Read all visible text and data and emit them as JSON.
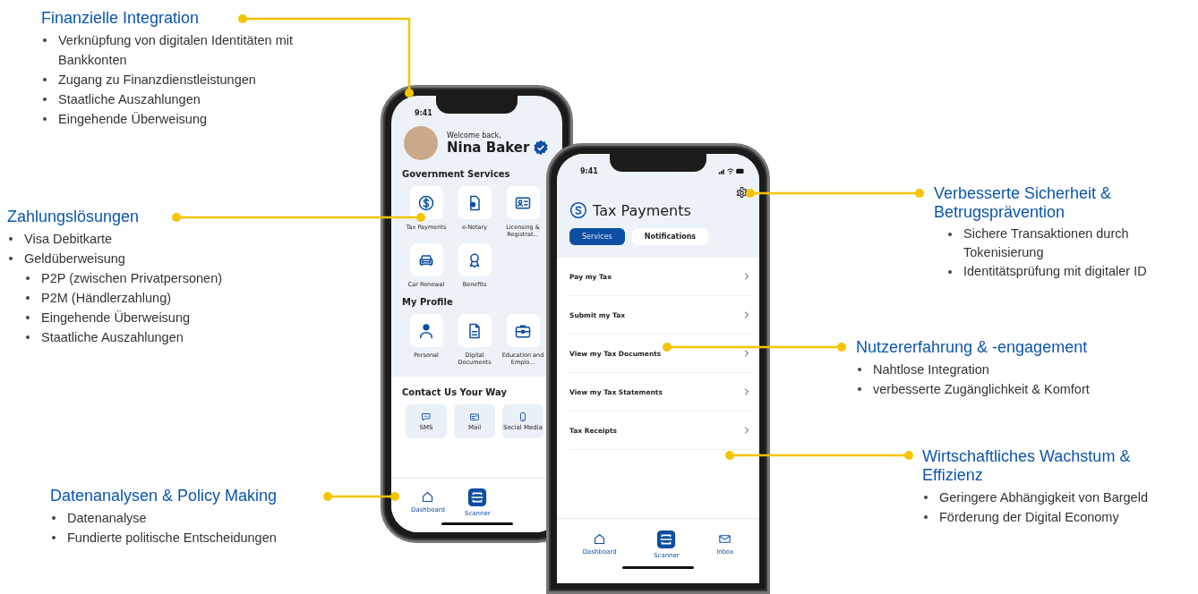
{
  "left_callouts": [
    {
      "title": "Finanzielle Integration",
      "bullets": [
        {
          "text": "Verknüpfung von digitalen Identitäten mit Bankkonten"
        },
        {
          "text": "Zugang zu Finanzdienstleistungen"
        },
        {
          "text": "Staatliche Auszahlungen"
        },
        {
          "text": "Eingehende Überweisung"
        }
      ]
    },
    {
      "title": "Zahlungslösungen",
      "bullets": [
        {
          "text": "Visa Debitkarte"
        },
        {
          "text": "Geldüberweisung",
          "children": [
            {
              "text": "P2P (zwischen Privatpersonen)"
            },
            {
              "text": "P2M (Händlerzahlung)"
            },
            {
              "text": "Eingehende Überweisung"
            },
            {
              "text": "Staatliche Auszahlungen"
            }
          ]
        }
      ]
    },
    {
      "title": "Datenanalysen & Policy Making",
      "bullets": [
        {
          "text": "Datenanalyse"
        },
        {
          "text": "Fundierte politische Entscheidungen"
        }
      ]
    }
  ],
  "phone_home": {
    "status_time": "9:41",
    "greeting": "Welcome back,",
    "user_name": "Nina Baker",
    "sections": [
      {
        "title": "Government Services",
        "kind": "grid",
        "items": [
          {
            "label": "Tax Payments"
          },
          {
            "label": "e-Notary"
          },
          {
            "label": "Licensing & Registrat..."
          },
          {
            "label": "Car Renewal"
          },
          {
            "label": "Benefits"
          }
        ]
      },
      {
        "title": "My Profile",
        "kind": "grid",
        "items": [
          {
            "label": "Personal"
          },
          {
            "label": "Digital Documents"
          },
          {
            "label": "Education and Emplo..."
          }
        ]
      },
      {
        "title": "Contact Us Your Way",
        "kind": "contact",
        "items": [
          {
            "label": "SMS"
          },
          {
            "label": "Mail"
          },
          {
            "label": "Social Media"
          }
        ]
      }
    ],
    "bottom_nav": [
      {
        "label": "Dashboard",
        "kind": "home"
      },
      {
        "label": "Scanner",
        "kind": "scanner"
      }
    ]
  },
  "phone_tax": {
    "status_time": "9:41",
    "title": "Tax Payments",
    "tabs": [
      {
        "label": "Services",
        "selected": true
      },
      {
        "label": "Notifications",
        "selected": false
      }
    ],
    "menu_items": [
      {
        "label": "Pay my Tax"
      },
      {
        "label": "Submit my Tax"
      },
      {
        "label": "View my Tax Documents"
      },
      {
        "label": "View my Tax Statements"
      },
      {
        "label": "Tax Receipts"
      }
    ],
    "bottom_nav": [
      {
        "label": "Dashboard",
        "kind": "home"
      },
      {
        "label": "Scanner",
        "kind": "scanner"
      },
      {
        "label": "Inbox",
        "kind": "inbox"
      }
    ]
  },
  "right_callouts": [
    {
      "title": "Verbesserte Sicherheit & Betrugsprävention",
      "bullets": [
        {
          "text": "Sichere Transaktionen durch Tokenisierung"
        },
        {
          "text": "Identitätsprüfung mit digitaler ID"
        }
      ]
    },
    {
      "title": "Nutzererfahrung & -engagement",
      "bullets": [
        {
          "text": "Nahtlose Integration"
        },
        {
          "text": "verbesserte Zugänglichkeit & Komfort"
        }
      ]
    },
    {
      "title": "Wirtschaftliches Wachstum & Effizienz",
      "bullets": [
        {
          "text": "Geringere Abhängigkeit von Bargeld"
        },
        {
          "text": "Förderung der Digital Economy"
        }
      ]
    }
  ]
}
